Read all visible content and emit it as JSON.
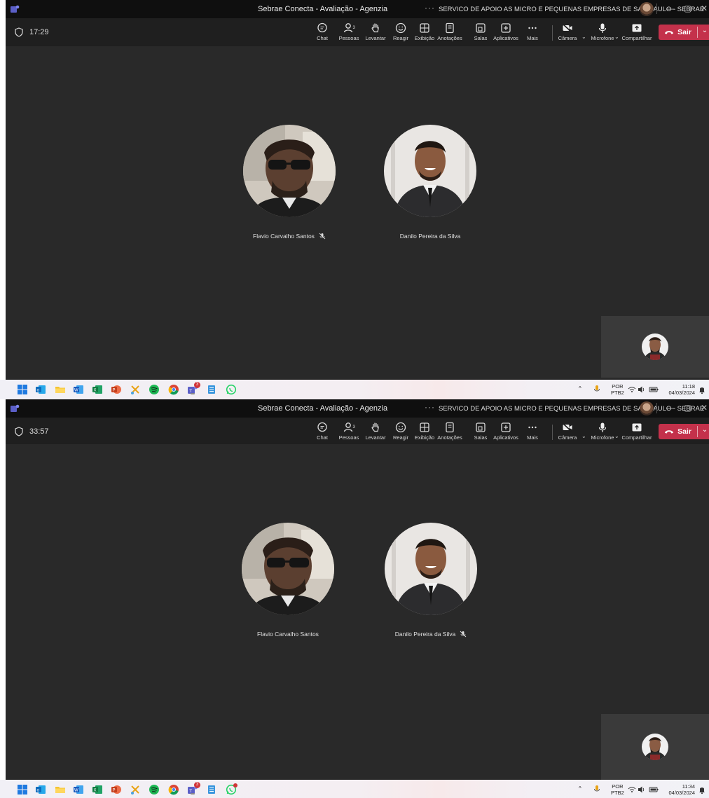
{
  "titlebar": {
    "title": "Sebrae Conecta - Avaliação - Agenzia",
    "more": "···",
    "org": "SERVICO DE APOIO AS MICRO E PEQUENAS EMPRESAS DE SAO PAULO - SEBRAE",
    "minimize": "—",
    "restore": "▢",
    "close": "✕"
  },
  "toolbar": {
    "chat": "Chat",
    "people": "Pessoas",
    "people_count": "3",
    "raise": "Levantar",
    "react": "Reagir",
    "view": "Exibição",
    "notes": "Anotações",
    "rooms": "Salas",
    "apps": "Aplicativos",
    "more": "Mais",
    "camera": "Câmera",
    "mic": "Microfone",
    "share": "Compartilhar",
    "leave": "Sair"
  },
  "participants": {
    "p1": "Flavio Carvalho Santos",
    "p2": "Danilo Pereira da Silva"
  },
  "shots": [
    {
      "timer": "17:29",
      "clock_time": "11:18",
      "clock_date": "04/03/2024"
    },
    {
      "timer": "33:57",
      "clock_time": "11:34",
      "clock_date": "04/03/2024"
    }
  ],
  "tray": {
    "lang": "POR",
    "layout": "PTB2",
    "up": "^"
  },
  "taskbar": {
    "teams_badge": "3"
  },
  "colors": {
    "leave_red": "#c4314b",
    "stage": "#292929",
    "toolbar": "#1f1f1f",
    "titlebar": "#0f0f0f"
  }
}
